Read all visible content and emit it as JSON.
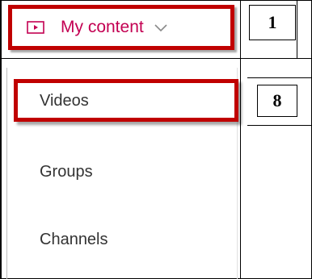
{
  "header": {
    "icon": "video-icon",
    "label": "My content",
    "chevron_icon": "chevron-down-icon",
    "accent_color": "#c30052"
  },
  "menu": {
    "items": [
      {
        "label": "Videos"
      },
      {
        "label": "Groups"
      },
      {
        "label": "Channels"
      }
    ]
  },
  "callouts": {
    "header_step": "1",
    "videos_step": "8",
    "highlight_color": "#c00000"
  }
}
